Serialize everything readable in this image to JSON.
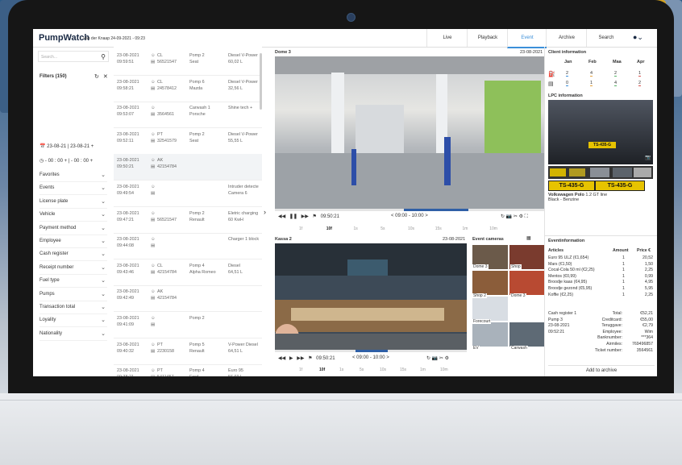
{
  "app": {
    "brand": "PumpWatch",
    "location_time": "Van der Knaap 24-09-2021 - 09:23"
  },
  "nav": [
    {
      "label": "Live"
    },
    {
      "label": "Playback"
    },
    {
      "label": "Event"
    },
    {
      "label": "Archive"
    },
    {
      "label": "Search"
    }
  ],
  "user_icon": "user-icon",
  "filters": {
    "search_placeholder": "Search...",
    "title": "Filters (150)",
    "date_range": "23-08-21 | 23-08-21 +",
    "time_range": "- 00 : 00 + | - 00 : 00 +",
    "items": [
      "Favorites",
      "Events",
      "License plate",
      "Vehicle",
      "Payment method",
      "Employee",
      "Cash register",
      "Receipt number",
      "Fuel type",
      "Pumps",
      "Transaction total",
      "Loyality",
      "Nationality"
    ]
  },
  "events": [
    {
      "date": "23-08-2021",
      "time": "09:59:51",
      "who": "CL",
      "num": "56521547",
      "pump": "Pomp 2",
      "car": "Seat",
      "fuel": "Diesel V-Power",
      "amount": "60,02 L"
    },
    {
      "date": "23-08-2021",
      "time": "09:58:21",
      "who": "CL",
      "num": "24578412",
      "pump": "Pomp 6",
      "car": "Mazda",
      "fuel": "Diesel V-Power",
      "amount": "32,56 L"
    },
    {
      "date": "23-08-2021",
      "time": "09:53:07",
      "who": "",
      "num": "3564561",
      "pump": "Carwash 1",
      "car": "Porsche",
      "fuel": "Shine tech +",
      "amount": ""
    },
    {
      "date": "23-08-2021",
      "time": "09:52:11",
      "who": "PT",
      "num": "32541579",
      "pump": "Pomp 2",
      "car": "Seat",
      "fuel": "Diesel V-Power",
      "amount": "55,55 L"
    },
    {
      "date": "23-08-2021",
      "time": "09:50:21",
      "who": "AK",
      "num": "42154784",
      "pump": "",
      "car": "",
      "fuel": "",
      "amount": ""
    },
    {
      "date": "23-08-2021",
      "time": "09:49:54",
      "who": "",
      "num": "",
      "pump": "",
      "car": "",
      "fuel": "Intruder detecte",
      "amount": "Camera 6"
    },
    {
      "date": "23-08-2021",
      "time": "09:47:21",
      "who": "",
      "num": "56521547",
      "pump": "Pomp 2",
      "car": "Renault",
      "fuel": "Eletric charging",
      "amount": "60 KwH"
    },
    {
      "date": "23-08-2021",
      "time": "09:44:08",
      "who": "",
      "num": "",
      "pump": "",
      "car": "",
      "fuel": "Charger 1 block",
      "amount": ""
    },
    {
      "date": "23-08-2021",
      "time": "09:43:46",
      "who": "CL",
      "num": "42154784",
      "pump": "Pomp 4",
      "car": "Alpha Romeo",
      "fuel": "Diesel",
      "amount": "64,51 L"
    },
    {
      "date": "23-08-2021",
      "time": "09:42:49",
      "who": "AK",
      "num": "42154784",
      "pump": "",
      "car": "",
      "fuel": "",
      "amount": ""
    },
    {
      "date": "23-08-2021",
      "time": "09:41:09",
      "who": "",
      "num": "",
      "pump": "Pomp 2",
      "car": "",
      "fuel": "",
      "amount": ""
    },
    {
      "date": "23-08-2021",
      "time": "09:40:32",
      "who": "PT",
      "num": "2230158",
      "pump": "Pomp 5",
      "car": "Renault",
      "fuel": "V-Power Diesel",
      "amount": "64,51 L"
    },
    {
      "date": "23-08-2021",
      "time": "09:38:21",
      "who": "PT",
      "num": "5411457",
      "pump": "Pomp 4",
      "car": "Ford",
      "fuel": "Euro 95",
      "amount": "56,69 L"
    }
  ],
  "video_top": {
    "title": "Dome 3",
    "date": "23-08-2021",
    "time": "09:50:21",
    "range": "< 09:00 - 10:00 >",
    "steps": [
      "1f",
      "10f",
      "1s",
      "5s",
      "10s",
      "15s",
      "1m",
      "10m"
    ]
  },
  "video_bottom": {
    "title": "Kassa 2",
    "date": "23-08-2021",
    "time": "09:50:21",
    "range": "< 09:00 - 10:00 >",
    "steps": [
      "1f",
      "10f",
      "1s",
      "5s",
      "10s",
      "15s",
      "1m",
      "10m"
    ]
  },
  "event_cameras": {
    "title": "Event cameras",
    "labels": [
      "Dome 3",
      "Shop",
      "Shop 2",
      "Dome 3",
      "Forecourt",
      "EV",
      "Carwash"
    ]
  },
  "client": {
    "title": "Client information",
    "months": [
      "Jan",
      "Feb",
      "Maa",
      "Apr"
    ],
    "row1": [
      "2",
      "4",
      "2",
      "1"
    ],
    "row2": [
      "0",
      "1",
      "4",
      "2"
    ],
    "lpc_title": "LPC information",
    "plate": "TS-435-G",
    "car": "Volkswagen Polo",
    "car_detail": "1.2 GT line",
    "car_color": "Black - Benzine"
  },
  "eventinfo": {
    "title": "Eventinformation",
    "headers": [
      "Articles",
      "Amount",
      "Price €"
    ],
    "articles": [
      [
        "Euro 95 ULZ (€1,654)",
        "1",
        "20,52"
      ],
      [
        "Mars (€1,50)",
        "1",
        "1,50"
      ],
      [
        "Cocal-Cola 50 ml (€2,25)",
        "1",
        "2,25"
      ],
      [
        "Mentos (€0,99)",
        "1",
        "0,99"
      ],
      [
        "Broodje kaas (€4,95)",
        "1",
        "4,95"
      ],
      [
        "Broodje gezond (€5,95)",
        "1",
        "5,95"
      ],
      [
        "Koffie (€2,25)",
        "1",
        "2,25"
      ]
    ],
    "left": [
      "Cash register 1",
      "Pump 3",
      "23-08-2021",
      "09:52:21"
    ],
    "totals": [
      [
        "Total:",
        "€52,21"
      ],
      [
        "Creditcard:",
        "€55,00"
      ],
      [
        "Teruggave:",
        "€2,79"
      ],
      [
        "Employee:",
        "Wim"
      ],
      [
        "Banknumber:",
        "***364"
      ],
      [
        "Airmiles:",
        "769496857"
      ],
      [
        "Ticket number:",
        "3564561"
      ]
    ],
    "archive": "Add to archive"
  }
}
